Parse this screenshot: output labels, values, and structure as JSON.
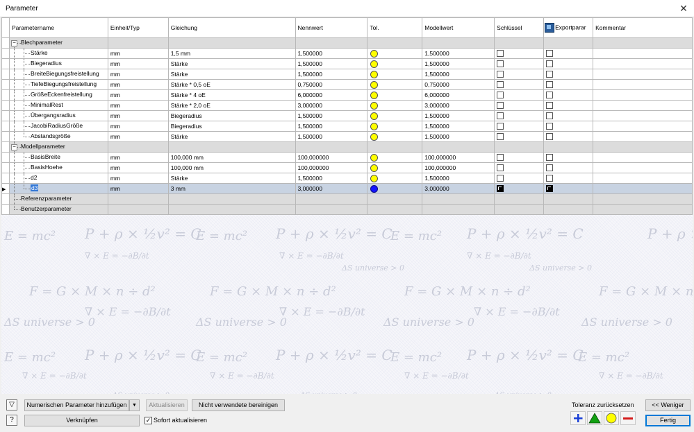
{
  "window": {
    "title": "Parameter",
    "close_glyph": "✕"
  },
  "columns": [
    "Parametername",
    "Einheit/Typ",
    "Gleichung",
    "Nennwert",
    "Tol.",
    "Modellwert",
    "Schlüssel",
    "Exportparar",
    "Kommentar"
  ],
  "rows": [
    {
      "type": "group",
      "level": 0,
      "name": "Blechparameter",
      "expander": "−"
    },
    {
      "type": "param",
      "level": 1,
      "name": "Stärke",
      "unit": "mm",
      "equation": "1,5 mm",
      "nominal": "1,500000",
      "tol": "yellow",
      "model": "1,500000",
      "key": false,
      "export": false
    },
    {
      "type": "param",
      "level": 1,
      "name": "Biegeradius",
      "unit": "mm",
      "equation": "Stärke",
      "nominal": "1,500000",
      "tol": "yellow",
      "model": "1,500000",
      "key": false,
      "export": false
    },
    {
      "type": "param",
      "level": 1,
      "name": "BreiteBiegungsfreistellung",
      "unit": "mm",
      "equation": "Stärke",
      "nominal": "1,500000",
      "tol": "yellow",
      "model": "1,500000",
      "key": false,
      "export": false
    },
    {
      "type": "param",
      "level": 1,
      "name": "TiefeBiegungsfreistellung",
      "unit": "mm",
      "equation": "Stärke * 0,5 oE",
      "nominal": "0,750000",
      "tol": "yellow",
      "model": "0,750000",
      "key": false,
      "export": false
    },
    {
      "type": "param",
      "level": 1,
      "name": "GrößeEckenfreistellung",
      "unit": "mm",
      "equation": "Stärke * 4 oE",
      "nominal": "6,000000",
      "tol": "yellow",
      "model": "6,000000",
      "key": false,
      "export": false
    },
    {
      "type": "param",
      "level": 1,
      "name": "MinimalRest",
      "unit": "mm",
      "equation": "Stärke * 2,0 oE",
      "nominal": "3,000000",
      "tol": "yellow",
      "model": "3,000000",
      "key": false,
      "export": false
    },
    {
      "type": "param",
      "level": 1,
      "name": "Übergangsradius",
      "unit": "mm",
      "equation": "Biegeradius",
      "nominal": "1,500000",
      "tol": "yellow",
      "model": "1,500000",
      "key": false,
      "export": false
    },
    {
      "type": "param",
      "level": 1,
      "name": "JacobiRadiusGröße",
      "unit": "mm",
      "equation": "Biegeradius",
      "nominal": "1,500000",
      "tol": "yellow",
      "model": "1,500000",
      "key": false,
      "export": false
    },
    {
      "type": "param",
      "level": 1,
      "name": "Abstandsgröße",
      "unit": "mm",
      "equation": "Stärke",
      "nominal": "1,500000",
      "tol": "yellow",
      "model": "1,500000",
      "key": false,
      "export": false,
      "last": true
    },
    {
      "type": "group",
      "level": 0,
      "name": "Modellparameter",
      "expander": "−"
    },
    {
      "type": "param",
      "level": 1,
      "name": "BasisBreite",
      "unit": "mm",
      "equation": "100,000 mm",
      "nominal": "100,000000",
      "tol": "yellow",
      "model": "100,000000",
      "key": false,
      "export": false
    },
    {
      "type": "param",
      "level": 1,
      "name": "BasisHoehe",
      "unit": "mm",
      "equation": "100,000 mm",
      "nominal": "100,000000",
      "tol": "yellow",
      "model": "100,000000",
      "key": false,
      "export": false
    },
    {
      "type": "param",
      "level": 1,
      "name": "d2",
      "unit": "mm",
      "equation": "Stärke",
      "nominal": "1,500000",
      "tol": "yellow",
      "model": "1,500000",
      "key": false,
      "export": false
    },
    {
      "type": "param",
      "level": 1,
      "name": "d3",
      "unit": "mm",
      "equation": "3 mm",
      "nominal": "3,000000",
      "tol": "blue",
      "model": "3,000000",
      "key": true,
      "export": true,
      "selected": true,
      "last": true
    },
    {
      "type": "group",
      "level": 0,
      "name": "Referenzparameter",
      "expander": ""
    },
    {
      "type": "group",
      "level": 0,
      "name": "Benutzerparameter",
      "expander": "",
      "last": true
    }
  ],
  "background_formulas": [
    "E = mc²",
    "P + ρ × ½v² = C",
    "∇ × E = −∂B/∂t",
    "ΔS universe > 0",
    "F = G × M × n ÷ d²"
  ],
  "bottom": {
    "add_numeric_label": "Numerischen Parameter hinzufügen",
    "dropdown_glyph": "▼",
    "update_label": "Aktualisieren",
    "purge_label": "Nicht verwendete bereinigen",
    "link_label": "Verknüpfen",
    "immediate_update_label": "Sofort aktualisieren",
    "immediate_update_checked": true,
    "tolerance_reset_label": "Toleranz zurücksetzen",
    "less_label": "<< Weniger",
    "done_label": "Fertig",
    "filter_glyph": "▽",
    "help_glyph": "?"
  },
  "colors": {
    "tol_yellow": "#ffff00",
    "tol_blue": "#1414ff",
    "tol_plus": "#1a3fd6",
    "tol_triangle": "#11a011",
    "tol_minus": "#d41a1a",
    "selection": "#c8d3e2",
    "primary_border": "#0078d7"
  }
}
